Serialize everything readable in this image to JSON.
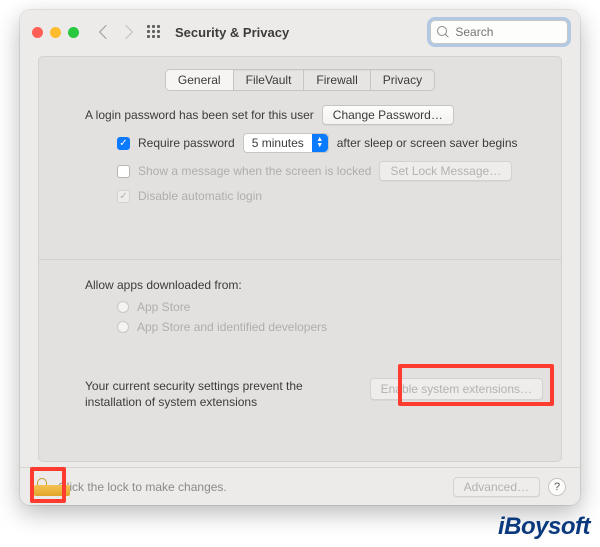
{
  "window": {
    "title": "Security & Privacy"
  },
  "search": {
    "placeholder": "Search"
  },
  "tabs": {
    "general": "General",
    "filevault": "FileVault",
    "firewall": "Firewall",
    "privacy": "Privacy"
  },
  "general": {
    "login_password_note": "A login password has been set for this user",
    "change_password_btn": "Change Password…",
    "require_password_label": "Require password",
    "require_password_delay": "5 minutes",
    "after_sleep_label": "after sleep or screen saver begins",
    "show_message_label": "Show a message when the screen is locked",
    "set_lock_message_btn": "Set Lock Message…",
    "disable_auto_login_label": "Disable automatic login"
  },
  "gatekeeper": {
    "heading": "Allow apps downloaded from:",
    "app_store": "App Store",
    "app_store_dev": "App Store and identified developers"
  },
  "extensions": {
    "note": "Your current security settings prevent the installation of system extensions",
    "button": "Enable system extensions…"
  },
  "footer": {
    "lock_note": "Click the lock to make changes.",
    "advanced_btn": "Advanced…",
    "help": "?"
  },
  "watermark": "iBoysoft"
}
